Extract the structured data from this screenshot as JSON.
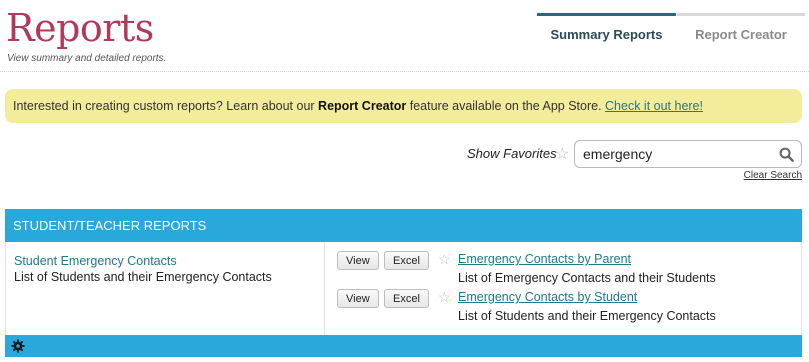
{
  "header": {
    "title": "Reports",
    "subtitle": "View summary and detailed reports.",
    "tabs": [
      {
        "label": "Summary Reports",
        "active": true
      },
      {
        "label": "Report Creator",
        "active": false
      }
    ]
  },
  "banner": {
    "text_before": "Interested in creating custom reports? Learn about our ",
    "bold_text": "Report Creator",
    "text_after": " feature available on the App Store. ",
    "link_text": "Check it out here!"
  },
  "search": {
    "favorites_label": "Show Favorites",
    "value": "emergency",
    "clear_label": "Clear Search"
  },
  "section": {
    "title": "STUDENT/TEACHER REPORTS",
    "group": {
      "title": "Student Emergency Contacts",
      "description": "List of Students and their Emergency Contacts"
    },
    "reports": [
      {
        "view_label": "View",
        "excel_label": "Excel",
        "title": "Emergency Contacts by Parent",
        "description": "List of Emergency Contacts and their Students"
      },
      {
        "view_label": "View",
        "excel_label": "Excel",
        "title": "Emergency Contacts by Student",
        "description": "List of Students and their Emergency Contacts"
      }
    ]
  },
  "colors": {
    "accent": "#29a9db",
    "title": "#b03a5e",
    "link": "#1e7a8a",
    "banner": "#f3ec9b"
  }
}
